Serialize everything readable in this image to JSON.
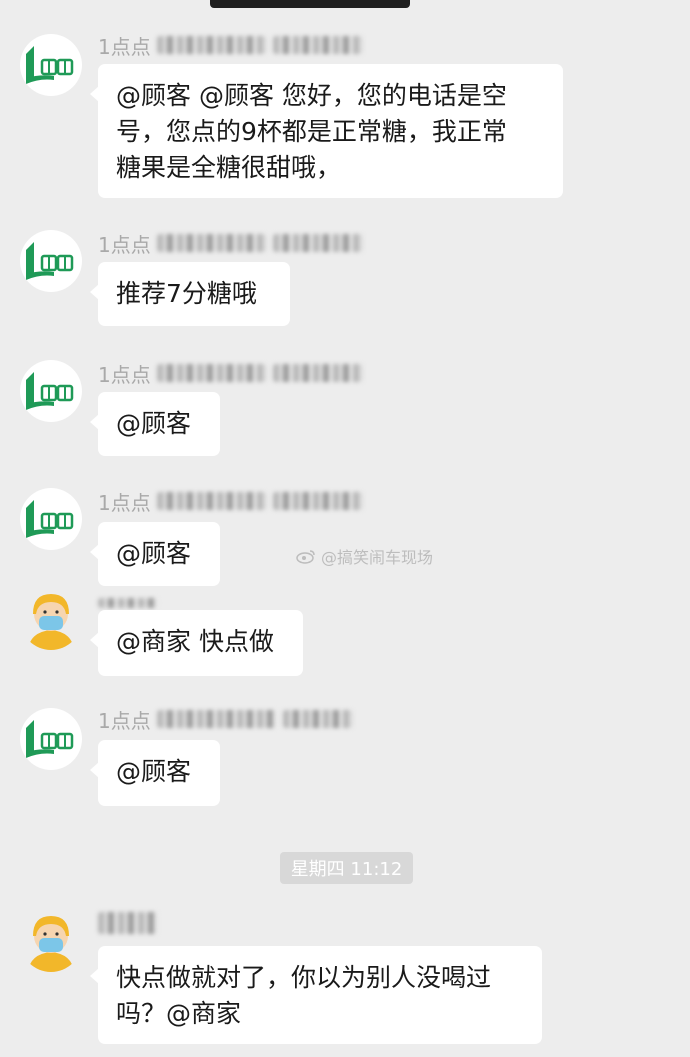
{
  "chat": {
    "messages": [
      {
        "sender": "1点点",
        "text_lines": [
          "@顾客 @顾客 您好，您的电话是空",
          "号，您点的9杯都是正常糖，我正常",
          "糖果是全糖很甜哦，"
        ],
        "avatar": "merchant-logo"
      },
      {
        "sender": "1点点",
        "text_lines": [
          "推荐7分糖哦"
        ],
        "avatar": "merchant-logo"
      },
      {
        "sender": "1点点",
        "text_lines": [
          "@顾客"
        ],
        "avatar": "merchant-logo"
      },
      {
        "sender": "1点点",
        "text_lines": [
          "@顾客"
        ],
        "avatar": "merchant-logo"
      },
      {
        "sender": "",
        "text_lines": [
          "@商家 快点做"
        ],
        "avatar": "rider-avatar"
      },
      {
        "sender": "1点点",
        "text_lines": [
          "@顾客"
        ],
        "avatar": "merchant-logo"
      },
      {
        "sender": "",
        "text_lines": [
          "快点做就对了，你以为别人没喝过",
          "吗？@商家"
        ],
        "avatar": "rider-avatar"
      }
    ],
    "timestamp": "星期四 11:12"
  },
  "watermark": "@搞笑闹车现场",
  "colors": {
    "background": "#ededed",
    "bubble": "#ffffff",
    "logo_green": "#1f9a57",
    "helmet": "#f2b72a",
    "mask": "#7cc6e8"
  }
}
